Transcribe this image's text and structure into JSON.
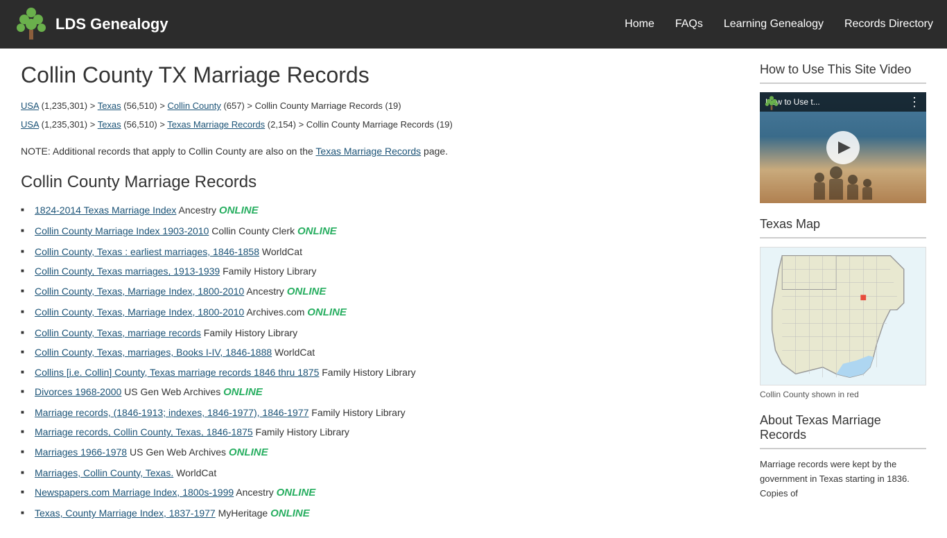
{
  "header": {
    "logo_text": "LDS Genealogy",
    "nav_items": [
      "Home",
      "FAQs",
      "Learning Genealogy",
      "Records Directory"
    ]
  },
  "main": {
    "page_title": "Collin County TX Marriage Records",
    "breadcrumbs": [
      {
        "line": "USA (1,235,301) > Texas (56,510) > Collin County (657) > Collin County Marriage Records (19)",
        "links": [
          "USA",
          "Texas",
          "Collin County"
        ]
      },
      {
        "line": "USA (1,235,301) > Texas (56,510) > Texas Marriage Records (2,154) > Collin County Marriage Records (19)",
        "links": [
          "USA",
          "Texas",
          "Texas Marriage Records"
        ]
      }
    ],
    "note": "NOTE: Additional records that apply to Collin County are also on the Texas Marriage Records page.",
    "note_link": "Texas Marriage Records",
    "section_title": "Collin County Marriage Records",
    "records": [
      {
        "link": "1824-2014 Texas Marriage Index",
        "provider": "Ancestry",
        "online": true
      },
      {
        "link": "Collin County Marriage Index 1903-2010",
        "provider": "Collin County Clerk",
        "online": true
      },
      {
        "link": "Collin County, Texas : earliest marriages, 1846-1858",
        "provider": "WorldCat",
        "online": false
      },
      {
        "link": "Collin County, Texas marriages, 1913-1939",
        "provider": "Family History Library",
        "online": false
      },
      {
        "link": "Collin County, Texas, Marriage Index, 1800-2010",
        "provider": "Ancestry",
        "online": true,
        "online2": false
      },
      {
        "link": "Collin County, Texas, Marriage Index, 1800-2010",
        "provider": "Archives.com",
        "online": true
      },
      {
        "link": "Collin County, Texas, marriage records",
        "provider": "Family History Library",
        "online": false
      },
      {
        "link": "Collin County, Texas, marriages, Books I-IV, 1846-1888",
        "provider": "WorldCat",
        "online": false
      },
      {
        "link": "Collins [i.e. Collin] County, Texas marriage records 1846 thru 1875",
        "provider": "Family History Library",
        "online": false
      },
      {
        "link": "Divorces 1968-2000",
        "provider": "US Gen Web Archives",
        "online": true
      },
      {
        "link": "Marriage records, (1846-1913; indexes, 1846-1977), 1846-1977",
        "provider": "Family History Library",
        "online": false
      },
      {
        "link": "Marriage records, Collin County, Texas, 1846-1875",
        "provider": "Family History Library",
        "online": false
      },
      {
        "link": "Marriages 1966-1978",
        "provider": "US Gen Web Archives",
        "online": true
      },
      {
        "link": "Marriages, Collin County, Texas.",
        "provider": "WorldCat",
        "online": false
      },
      {
        "link": "Newspapers.com Marriage Index, 1800s-1999",
        "provider": "Ancestry",
        "online": true
      },
      {
        "link": "Texas, County Marriage Index, 1837-1977",
        "provider": "MyHeritage",
        "online": true
      }
    ]
  },
  "sidebar": {
    "video_section_title": "How to Use This Site Video",
    "video_title": "How to Use t...",
    "map_section_title": "Texas Map",
    "map_caption": "Collin County shown in red",
    "about_section_title": "About Texas Marriage Records",
    "about_text": "Marriage records were kept by the government in Texas starting in 1836. Copies of"
  }
}
